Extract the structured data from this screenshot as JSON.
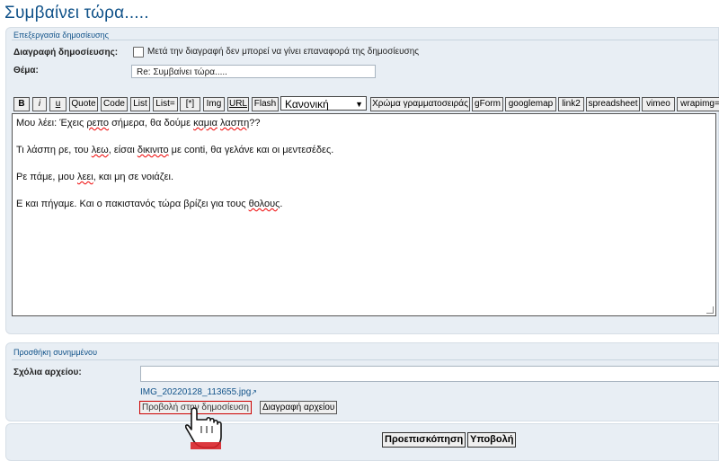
{
  "page": {
    "title": "Συμβαίνει τώρα....."
  },
  "edit_panel": {
    "header": "Επεξεργασία δημοσίευσης",
    "delete_label": "Διαγραφή δημοσίευσης:",
    "delete_checked": false,
    "delete_note": "Μετά την διαγραφή δεν μπορεί να γίνει επαναφορά της δημοσίευσης",
    "subject_label": "Θέμα:",
    "subject_value": "Re: Συμβαίνει τώρα....."
  },
  "toolbar": {
    "buttons": [
      "B",
      "i",
      "u",
      "Quote",
      "Code",
      "List",
      "List=",
      "[*]",
      "Img",
      "URL",
      "Flash"
    ],
    "font_size_selected": "Κανονική",
    "extra_buttons": [
      "Χρώμα γραμματοσειράς",
      "gForm",
      "googlemap",
      "link2",
      "spreadsheet",
      "vimeo",
      "wrapimg="
    ]
  },
  "editor": {
    "lines": [
      [
        "Μου λέει: Έχεις ",
        {
          "t": "ρεπο",
          "sp": true
        },
        " σήμερα, θα δούμε ",
        {
          "t": "καμια",
          "sp": true
        },
        " ",
        {
          "t": "λασπη",
          "sp": true
        },
        "??"
      ],
      [
        "Τι λάσπη ρε, του ",
        {
          "t": "λεω",
          "sp": true
        },
        ", είσαι ",
        {
          "t": "δικινιτο",
          "sp": true
        },
        " με conti, θα γελάνε και οι μεντεσέδες."
      ],
      [
        "Ρε πάμε, μου ",
        {
          "t": "λεει",
          "sp": true
        },
        ", και μη σε νοιάζει."
      ],
      [
        "Ε και πήγαμε. Και ο πακιστανός τώρα βρίζει για τους ",
        {
          "t": "θολους",
          "sp": true
        },
        "."
      ]
    ]
  },
  "attach_panel": {
    "header": "Προσθήκη συνημμένου",
    "comment_label": "Σχόλια αρχείου:",
    "comment_value": "",
    "file_name": "IMG_20220128_113655.jpg",
    "inline_button": "Προβολή στην δημοσίευση",
    "delete_file_button": "Διαγραφή αρχείου"
  },
  "actions": {
    "preview": "Προεπισκόπηση",
    "submit": "Υποβολή"
  }
}
